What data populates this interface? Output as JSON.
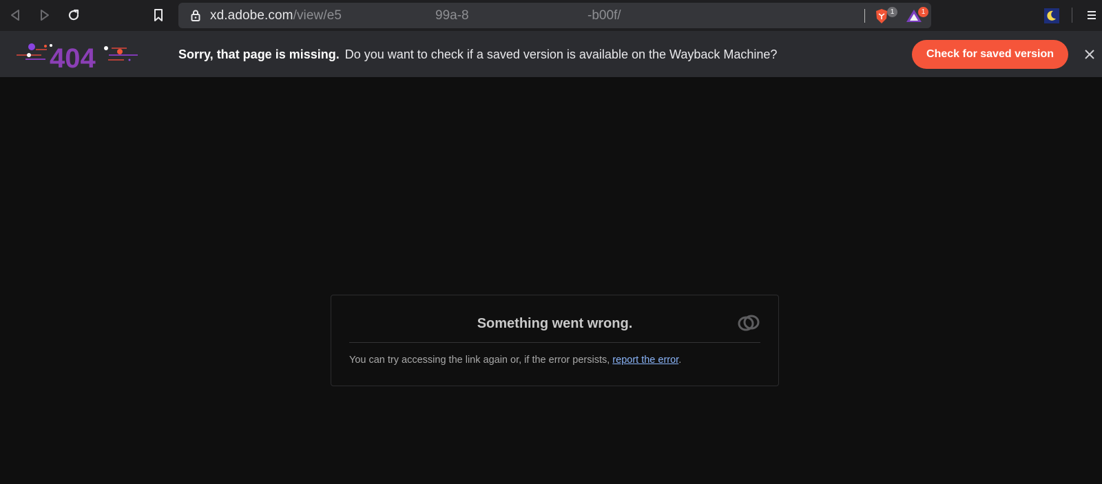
{
  "browser": {
    "url": {
      "host": "xd.adobe.com",
      "path_start": "/view/e5",
      "fragment_middle": "99a-8",
      "fragment_end": "-b00f/"
    },
    "extensions": [
      {
        "name": "brave-shields-icon",
        "badge": "1",
        "color": "#6e6e72"
      },
      {
        "name": "brave-rewards-icon",
        "badge": "1",
        "color": "#f05537"
      }
    ]
  },
  "banner": {
    "logo_text": "404",
    "bold_text": "Sorry, that page is missing.",
    "text": "Do you want to check if a saved version is available on the Wayback Machine?",
    "button_label": "Check for saved version",
    "accent": "#f5553a"
  },
  "error_card": {
    "title": "Something went wrong.",
    "message": "You can try accessing the link again or, if the error persists, ",
    "link_text": "report the error",
    "trailing": "."
  }
}
